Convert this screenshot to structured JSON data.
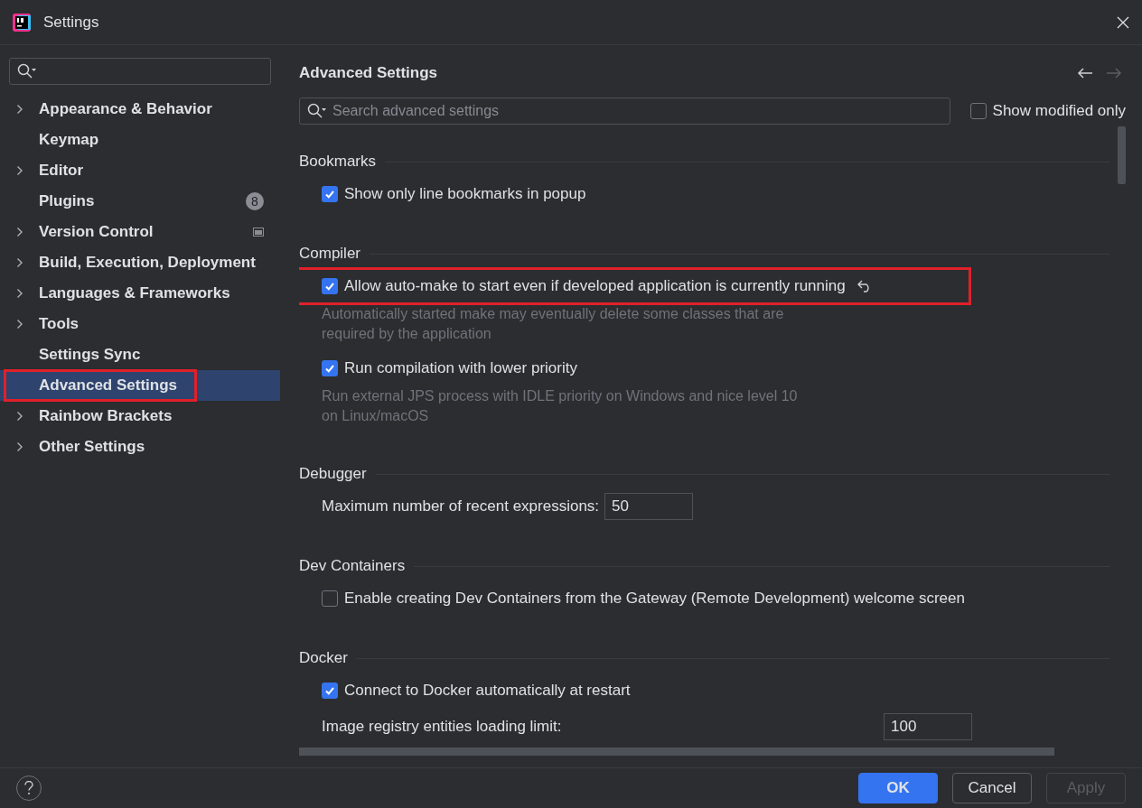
{
  "window": {
    "title": "Settings"
  },
  "sidebar": {
    "items": [
      {
        "label": "Appearance & Behavior",
        "expandable": true,
        "selected": false,
        "highlighted": false
      },
      {
        "label": "Keymap",
        "expandable": false,
        "selected": false,
        "highlighted": false
      },
      {
        "label": "Editor",
        "expandable": true,
        "selected": false,
        "highlighted": false
      },
      {
        "label": "Plugins",
        "expandable": false,
        "selected": false,
        "highlighted": false,
        "badge": "8"
      },
      {
        "label": "Version Control",
        "expandable": true,
        "selected": false,
        "highlighted": false,
        "project_scoped": true
      },
      {
        "label": "Build, Execution, Deployment",
        "expandable": true,
        "selected": false,
        "highlighted": false
      },
      {
        "label": "Languages & Frameworks",
        "expandable": true,
        "selected": false,
        "highlighted": false
      },
      {
        "label": "Tools",
        "expandable": true,
        "selected": false,
        "highlighted": false
      },
      {
        "label": "Settings Sync",
        "expandable": false,
        "selected": false,
        "highlighted": false
      },
      {
        "label": "Advanced Settings",
        "expandable": false,
        "selected": true,
        "highlighted": true
      },
      {
        "label": "Rainbow Brackets",
        "expandable": true,
        "selected": false,
        "highlighted": false
      },
      {
        "label": "Other Settings",
        "expandable": true,
        "selected": false,
        "highlighted": false
      }
    ]
  },
  "page": {
    "title": "Advanced Settings",
    "search": {
      "placeholder": "Search advanced settings"
    },
    "show_modified_only": {
      "label": "Show modified only",
      "checked": false
    },
    "sections": [
      {
        "title": "Bookmarks",
        "items": [
          {
            "kind": "checkbox",
            "label": "Show only line bookmarks in popup",
            "checked": true,
            "highlighted": false,
            "modified": false
          }
        ]
      },
      {
        "title": "Compiler",
        "items": [
          {
            "kind": "checkbox",
            "label": "Allow auto-make to start even if developed application is currently running",
            "checked": true,
            "highlighted": true,
            "modified": true,
            "description": "Automatically started make may eventually delete some classes that are required by the application"
          },
          {
            "kind": "checkbox",
            "label": "Run compilation with lower priority",
            "checked": true,
            "highlighted": false,
            "modified": false,
            "description": "Run external JPS process with IDLE priority on Windows and nice level 10 on Linux/macOS"
          }
        ]
      },
      {
        "title": "Debugger",
        "items": [
          {
            "kind": "number",
            "label": "Maximum number of recent expressions:",
            "value": "50"
          }
        ]
      },
      {
        "title": "Dev Containers",
        "items": [
          {
            "kind": "checkbox",
            "label": "Enable creating Dev Containers from the Gateway (Remote Development) welcome screen",
            "checked": false,
            "highlighted": false,
            "modified": false
          }
        ]
      },
      {
        "title": "Docker",
        "items": [
          {
            "kind": "checkbox",
            "label": "Connect to Docker automatically at restart",
            "checked": true,
            "highlighted": false,
            "modified": false
          },
          {
            "kind": "number",
            "label": "Image registry entities loading limit:",
            "value": "100"
          }
        ]
      }
    ]
  },
  "buttons": [
    {
      "label": "OK",
      "kind": "primary",
      "disabled": false
    },
    {
      "label": "Cancel",
      "kind": "normal",
      "disabled": false
    },
    {
      "label": "Apply",
      "kind": "normal",
      "disabled": true
    }
  ]
}
